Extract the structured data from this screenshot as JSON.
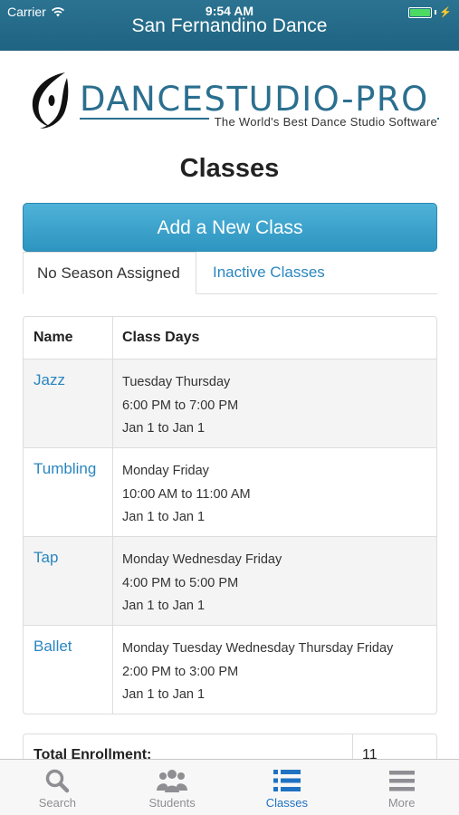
{
  "status_bar": {
    "carrier": "Carrier",
    "time": "9:54 AM"
  },
  "app_title": "San Fernandino Dance",
  "logo": {
    "brand": "DANCESTUDIO-PRO",
    "tagline": "The World's Best Dance Studio Software"
  },
  "page_title": "Classes",
  "add_button_label": "Add a New Class",
  "tabs": [
    {
      "label": "No Season Assigned",
      "active": true
    },
    {
      "label": "Inactive Classes",
      "active": false
    }
  ],
  "table": {
    "headers": [
      "Name",
      "Class Days"
    ],
    "rows": [
      {
        "name": "Jazz",
        "days": "Tuesday Thursday",
        "time": "6:00 PM to 7:00 PM",
        "dates": "Jan 1 to Jan 1"
      },
      {
        "name": "Tumbling",
        "days": "Monday Friday",
        "time": "10:00 AM to 11:00 AM",
        "dates": "Jan 1 to Jan 1"
      },
      {
        "name": "Tap",
        "days": "Monday Wednesday Friday",
        "time": "4:00 PM to 5:00 PM",
        "dates": "Jan 1 to Jan 1"
      },
      {
        "name": "Ballet",
        "days": "Monday Tuesday Wednesday Thursday Friday",
        "time": "2:00 PM to 3:00 PM",
        "dates": "Jan 1 to Jan 1"
      }
    ]
  },
  "enrollment": {
    "label": "Total Enrollment:",
    "value": "11"
  },
  "tab_bar": [
    {
      "label": "Search",
      "icon": "search-icon",
      "active": false
    },
    {
      "label": "Students",
      "icon": "students-icon",
      "active": false
    },
    {
      "label": "Classes",
      "icon": "list-icon",
      "active": true
    },
    {
      "label": "More",
      "icon": "menu-icon",
      "active": false
    }
  ],
  "colors": {
    "header": "#1f6482",
    "accent": "#2a86c0",
    "button": "#3aa4cf",
    "battery": "#4cd964"
  }
}
